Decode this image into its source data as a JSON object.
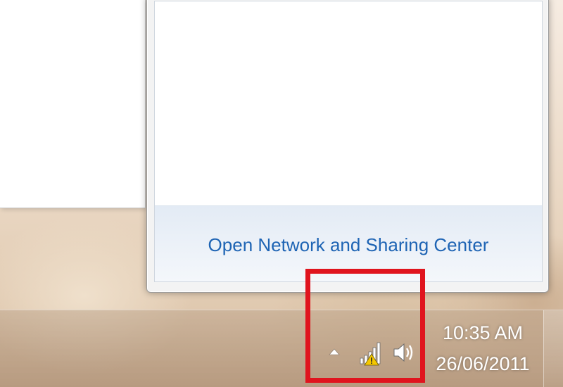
{
  "flyout": {
    "footer_link": "Open Network and Sharing Center"
  },
  "tray": {
    "icons": {
      "expand": "show-hidden-icons-triangle",
      "network": "wireless-signal-warning-icon",
      "volume": "speaker-volume-icon"
    },
    "clock": {
      "time": "10:35 AM",
      "date": "26/06/2011"
    }
  },
  "annotation": {
    "color": "#e0141e"
  },
  "colors": {
    "link": "#1e64b4",
    "warning": "#f5c800"
  }
}
